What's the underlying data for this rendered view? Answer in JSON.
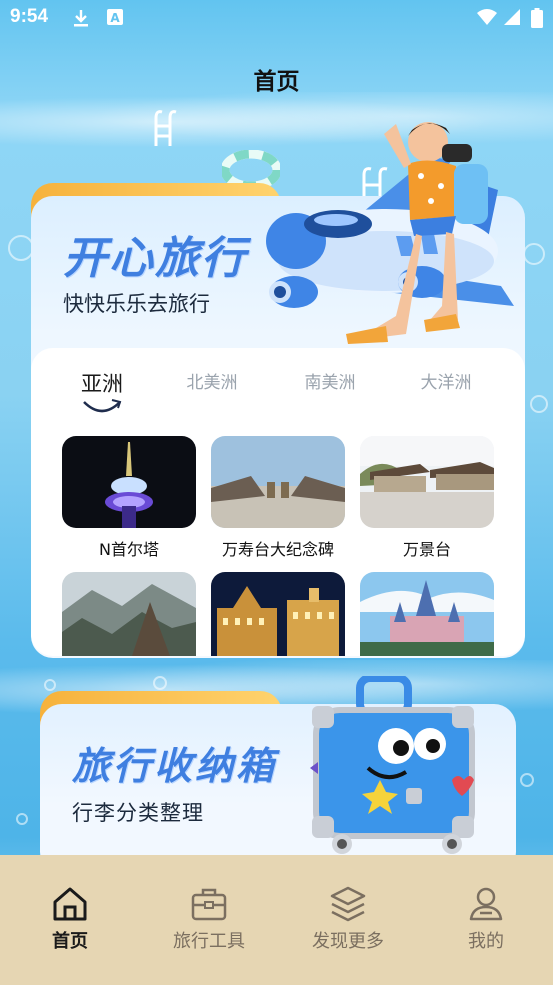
{
  "status_bar": {
    "time": "9:54"
  },
  "header": {
    "title": "首页"
  },
  "hero": {
    "title": "开心旅行",
    "subtitle": "快快乐乐去旅行"
  },
  "regions": {
    "tabs": [
      {
        "label": "亚洲",
        "active": true
      },
      {
        "label": "北美洲",
        "active": false
      },
      {
        "label": "南美洲",
        "active": false
      },
      {
        "label": "大洋洲",
        "active": false
      }
    ],
    "spots": [
      {
        "label": "N首尔塔"
      },
      {
        "label": "万寿台大纪念碑"
      },
      {
        "label": "万景台"
      },
      {
        "label": ""
      },
      {
        "label": ""
      },
      {
        "label": ""
      }
    ]
  },
  "storage": {
    "title": "旅行收纳箱",
    "subtitle": "行李分类整理"
  },
  "nav": {
    "items": [
      {
        "label": "首页",
        "icon": "home-icon",
        "active": true
      },
      {
        "label": "旅行工具",
        "icon": "toolbox-icon",
        "active": false
      },
      {
        "label": "发现更多",
        "icon": "layers-icon",
        "active": false
      },
      {
        "label": "我的",
        "icon": "user-icon",
        "active": false
      }
    ]
  },
  "colors": {
    "accent_blue": "#3f7fe0",
    "tab_orange": "#f6b23c",
    "nav_bg": "#e6d6b3"
  }
}
